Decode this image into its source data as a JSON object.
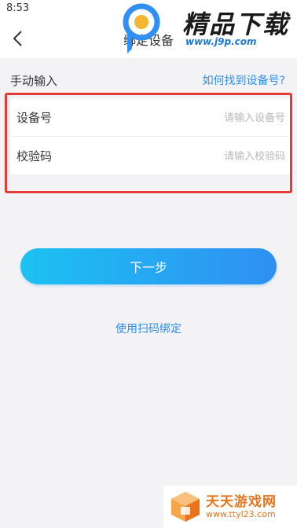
{
  "status_bar": {
    "time": "8:53"
  },
  "nav": {
    "title": "绑定设备"
  },
  "watermark": {
    "brand": "精品下载",
    "url": "www.j9p.com"
  },
  "section": {
    "title": "手动输入",
    "help_link": "如何找到设备号?"
  },
  "form": {
    "device": {
      "label": "设备号",
      "placeholder": "请输入设备号",
      "value": ""
    },
    "code": {
      "label": "校验码",
      "placeholder": "请输入校验码",
      "value": ""
    }
  },
  "actions": {
    "next_label": "下一步",
    "scan_label": "使用扫码绑定"
  },
  "watermark2": {
    "brand": "天天游戏网",
    "url": "www.ttyl23.com"
  },
  "colors": {
    "accent": "#2b8ef5",
    "highlight_border": "#e53935",
    "button_gradient_start": "#1cc2f3",
    "button_gradient_end": "#2f8ff2"
  },
  "icons": {
    "back": "chevron-left-icon"
  }
}
